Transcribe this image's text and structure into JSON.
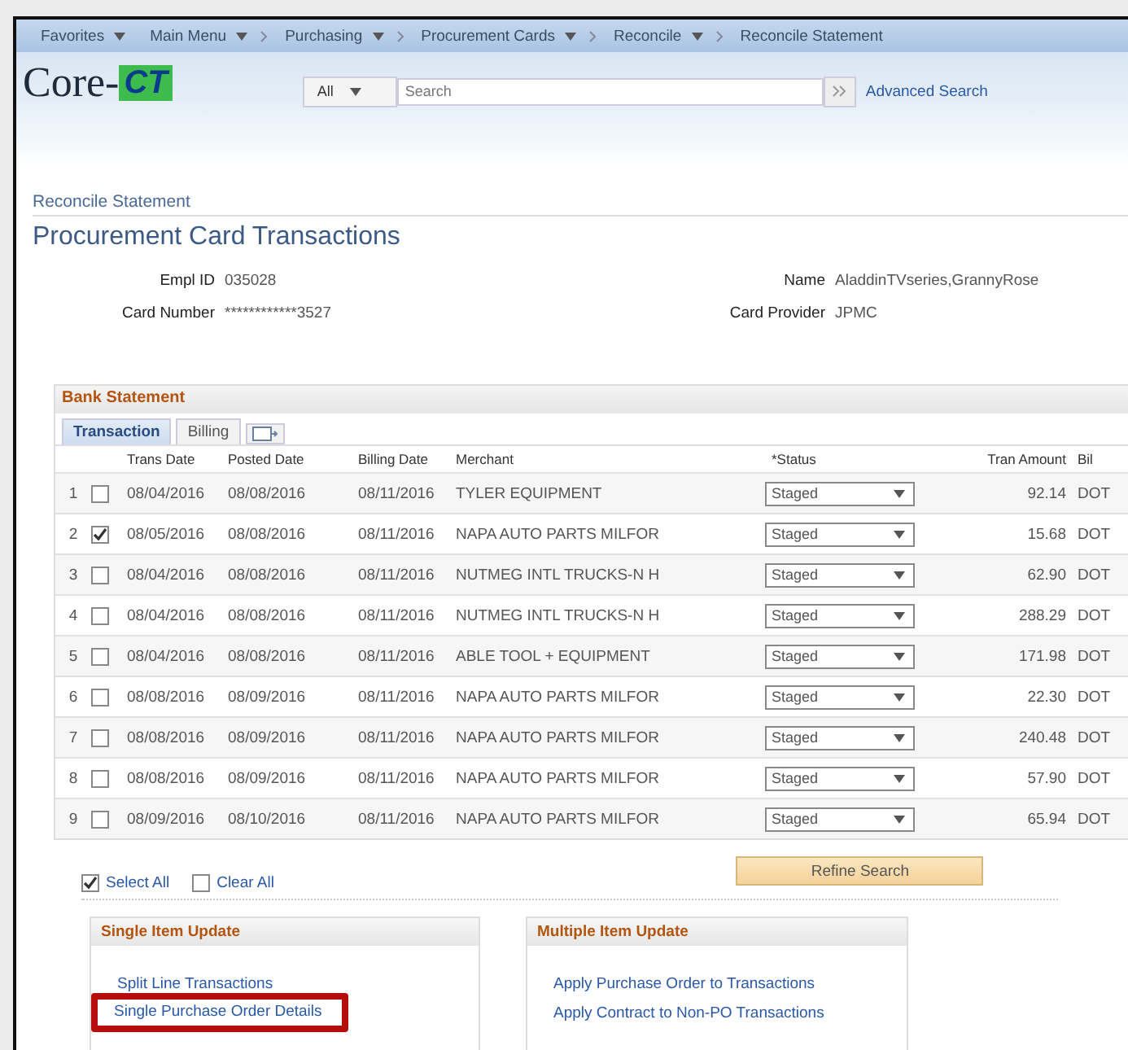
{
  "nav": [
    {
      "label": "Favorites",
      "has_menu": true
    },
    {
      "label": "Main Menu",
      "has_menu": true
    },
    {
      "label": "Purchasing",
      "has_menu": true
    },
    {
      "label": "Procurement Cards",
      "has_menu": true
    },
    {
      "label": "Reconcile",
      "has_menu": true
    },
    {
      "label": "Reconcile Statement",
      "has_menu": false
    }
  ],
  "logo": {
    "text": "Core-",
    "mark": "CT"
  },
  "search": {
    "scope": "All",
    "placeholder": "Search",
    "advanced": "Advanced Search"
  },
  "page": {
    "breadcrumb": "Reconcile Statement",
    "title": "Procurement Card Transactions"
  },
  "fields": [
    {
      "label": "Empl ID",
      "value": "035028"
    },
    {
      "label": "Name",
      "value": "AladdinTVseries,GrannyRose"
    },
    {
      "label": "Card Number",
      "value": "************3527"
    },
    {
      "label": "Card Provider",
      "value": "JPMC"
    }
  ],
  "grid": {
    "title": "Bank Statement",
    "tabs": [
      {
        "label": "Transaction",
        "selected": true
      },
      {
        "label": "Billing",
        "selected": false
      }
    ],
    "columns": [
      "Trans Date",
      "Posted Date",
      "Billing Date",
      "Merchant",
      "*Status",
      "Tran Amount",
      "Bil"
    ],
    "rows": [
      {
        "num": "1",
        "checked": false,
        "trans_date": "08/04/2016",
        "posted_date": "08/08/2016",
        "billing_date": "08/11/2016",
        "merchant": "TYLER EQUIPMENT",
        "status": "Staged",
        "amount": "92.14",
        "currency": "DOT"
      },
      {
        "num": "2",
        "checked": true,
        "trans_date": "08/05/2016",
        "posted_date": "08/08/2016",
        "billing_date": "08/11/2016",
        "merchant": "NAPA AUTO PARTS MILFOR",
        "status": "Staged",
        "amount": "15.68",
        "currency": "DOT"
      },
      {
        "num": "3",
        "checked": false,
        "trans_date": "08/04/2016",
        "posted_date": "08/08/2016",
        "billing_date": "08/11/2016",
        "merchant": "NUTMEG INTL TRUCKS-N H",
        "status": "Staged",
        "amount": "62.90",
        "currency": "DOT"
      },
      {
        "num": "4",
        "checked": false,
        "trans_date": "08/04/2016",
        "posted_date": "08/08/2016",
        "billing_date": "08/11/2016",
        "merchant": "NUTMEG INTL TRUCKS-N H",
        "status": "Staged",
        "amount": "288.29",
        "currency": "DOT"
      },
      {
        "num": "5",
        "checked": false,
        "trans_date": "08/04/2016",
        "posted_date": "08/08/2016",
        "billing_date": "08/11/2016",
        "merchant": "ABLE TOOL + EQUIPMENT",
        "status": "Staged",
        "amount": "171.98",
        "currency": "DOT"
      },
      {
        "num": "6",
        "checked": false,
        "trans_date": "08/08/2016",
        "posted_date": "08/09/2016",
        "billing_date": "08/11/2016",
        "merchant": "NAPA AUTO PARTS MILFOR",
        "status": "Staged",
        "amount": "22.30",
        "currency": "DOT"
      },
      {
        "num": "7",
        "checked": false,
        "trans_date": "08/08/2016",
        "posted_date": "08/09/2016",
        "billing_date": "08/11/2016",
        "merchant": "NAPA AUTO PARTS MILFOR",
        "status": "Staged",
        "amount": "240.48",
        "currency": "DOT"
      },
      {
        "num": "8",
        "checked": false,
        "trans_date": "08/08/2016",
        "posted_date": "08/09/2016",
        "billing_date": "08/11/2016",
        "merchant": "NAPA AUTO PARTS MILFOR",
        "status": "Staged",
        "amount": "57.90",
        "currency": "DOT"
      },
      {
        "num": "9",
        "checked": false,
        "trans_date": "08/09/2016",
        "posted_date": "08/10/2016",
        "billing_date": "08/11/2016",
        "merchant": "NAPA AUTO PARTS MILFOR",
        "status": "Staged",
        "amount": "65.94",
        "currency": "DOT"
      }
    ]
  },
  "actions": {
    "select_all": "Select All",
    "clear_all": "Clear All",
    "refine": "Refine Search"
  },
  "panels": [
    {
      "title": "Single Item Update",
      "links": [
        {
          "label": "Split Line Transactions",
          "highlighted": false
        },
        {
          "label": "Single Purchase Order Details",
          "highlighted": true
        }
      ]
    },
    {
      "title": "Multiple Item Update",
      "links": [
        {
          "label": "Apply Purchase Order to Transactions",
          "highlighted": false
        },
        {
          "label": "Apply Contract to Non-PO Transactions",
          "highlighted": false
        }
      ]
    }
  ]
}
